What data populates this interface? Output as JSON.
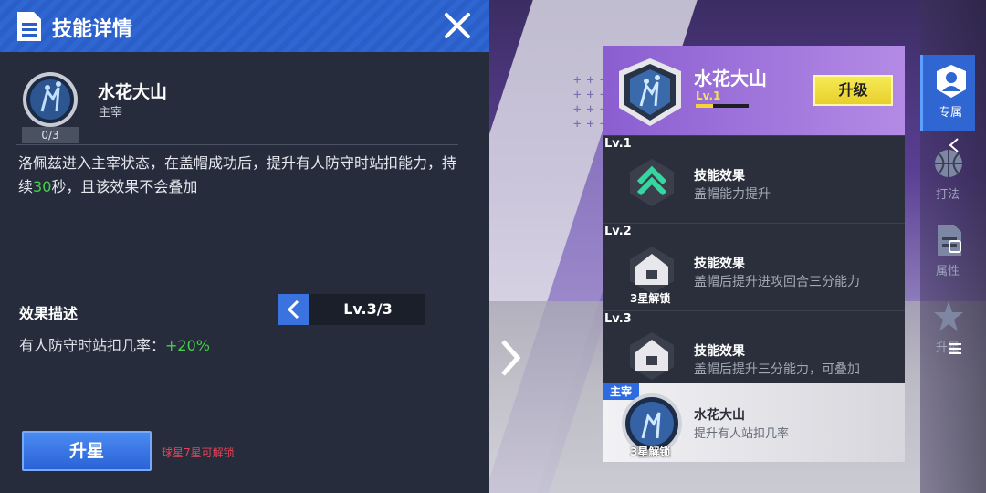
{
  "header": {
    "title": "技能详情"
  },
  "skill": {
    "name": "水花大山",
    "type": "主宰",
    "count": "0/3",
    "description_prefix": "洛佩兹进入主宰状态，在盖帽成功后，提升有人防守时站扣能力，持续",
    "description_number": "30",
    "description_suffix": "秒，且该效果不会叠加"
  },
  "effect": {
    "label": "效果描述",
    "level": "Lv.3/3",
    "stat_label": "有人防守时站扣几率：",
    "stat_value": "+20%"
  },
  "actions": {
    "upgrade_star": "升星",
    "unlock_note": "球星7星可解锁"
  },
  "card": {
    "name": "水花大山",
    "level": "Lv.1",
    "level_progress": 0.33,
    "upgrade": "升级"
  },
  "levels": [
    {
      "tag": "Lv.1",
      "title": "技能效果",
      "sub": "盖帽能力提升",
      "lock": ""
    },
    {
      "tag": "Lv.2",
      "title": "技能效果",
      "sub": "盖帽后提升进攻回合三分能力",
      "lock": "3星解锁"
    },
    {
      "tag": "Lv.3",
      "title": "技能效果",
      "sub": "盖帽后提升三分能力，可叠加",
      "lock": "3星解锁"
    }
  ],
  "main_skill": {
    "tag": "主宰",
    "name": "水花大山",
    "sub": "提升有人站扣几率",
    "lock": "3星解锁"
  },
  "tabs": [
    {
      "label": "专属",
      "icon": "player-icon"
    },
    {
      "label": "打法",
      "icon": "basketball-icon"
    },
    {
      "label": "属性",
      "icon": "document-icon"
    },
    {
      "label": "升星",
      "icon": "star-icon"
    }
  ],
  "colors": {
    "accent_blue": "#2f66d2",
    "upgrade_yellow": "#f6ea55",
    "positive_green": "#46d04b",
    "warning_red": "#e0455a",
    "card_purple": "#8a5ed0"
  }
}
